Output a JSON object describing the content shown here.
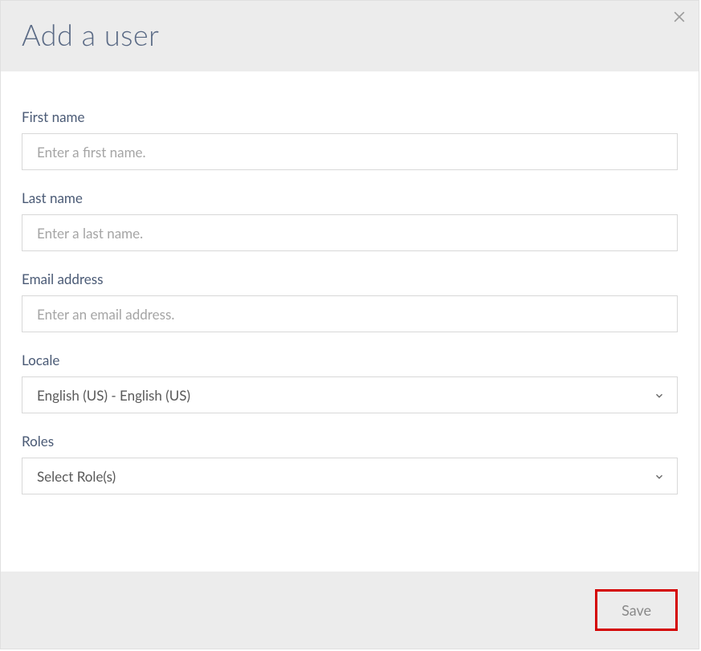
{
  "header": {
    "title": "Add a user"
  },
  "form": {
    "first_name": {
      "label": "First name",
      "placeholder": "Enter a first name.",
      "value": ""
    },
    "last_name": {
      "label": "Last name",
      "placeholder": "Enter a last name.",
      "value": ""
    },
    "email": {
      "label": "Email address",
      "placeholder": "Enter an email address.",
      "value": ""
    },
    "locale": {
      "label": "Locale",
      "selected": "English (US) - English (US)"
    },
    "roles": {
      "label": "Roles",
      "selected": "Select Role(s)"
    }
  },
  "footer": {
    "save_label": "Save"
  }
}
